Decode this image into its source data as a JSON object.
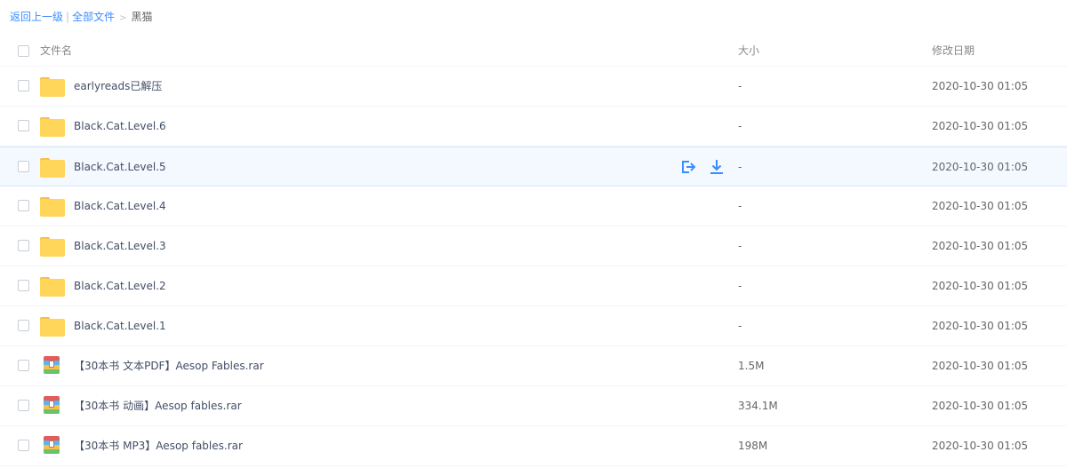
{
  "breadcrumb": {
    "back_label": "返回上一级",
    "separator": "|",
    "all_files_label": "全部文件",
    "arrow": ">",
    "current": "黑猫"
  },
  "header": {
    "name_label": "文件名",
    "size_label": "大小",
    "date_label": "修改日期"
  },
  "colors": {
    "accent": "#3b8cff",
    "folder": "#ffd659",
    "hover_row": "#f4f9ff"
  },
  "files": [
    {
      "type": "folder",
      "icon": "folder-icon",
      "name": "earlyreads已解压",
      "size": "-",
      "date": "2020-10-30 01:05"
    },
    {
      "type": "folder",
      "icon": "folder-icon",
      "name": "Black.Cat.Level.6",
      "size": "-",
      "date": "2020-10-30 01:05"
    },
    {
      "type": "folder",
      "icon": "folder-icon",
      "name": "Black.Cat.Level.5",
      "size": "-",
      "date": "2020-10-30 01:05",
      "hovered": true
    },
    {
      "type": "folder",
      "icon": "folder-icon",
      "name": "Black.Cat.Level.4",
      "size": "-",
      "date": "2020-10-30 01:05"
    },
    {
      "type": "folder",
      "icon": "folder-icon",
      "name": "Black.Cat.Level.3",
      "size": "-",
      "date": "2020-10-30 01:05"
    },
    {
      "type": "folder",
      "icon": "folder-icon",
      "name": "Black.Cat.Level.2",
      "size": "-",
      "date": "2020-10-30 01:05"
    },
    {
      "type": "folder",
      "icon": "folder-icon",
      "name": "Black.Cat.Level.1",
      "size": "-",
      "date": "2020-10-30 01:05"
    },
    {
      "type": "rar",
      "icon": "rar-archive-icon",
      "name": "【30本书 文本PDF】Aesop Fables.rar",
      "size": "1.5M",
      "date": "2020-10-30 01:05"
    },
    {
      "type": "rar",
      "icon": "rar-archive-icon",
      "name": "【30本书 动画】Aesop fables.rar",
      "size": "334.1M",
      "date": "2020-10-30 01:05"
    },
    {
      "type": "rar",
      "icon": "rar-archive-icon",
      "name": "【30本书 MP3】Aesop fables.rar",
      "size": "198M",
      "date": "2020-10-30 01:05"
    }
  ],
  "row_actions": {
    "share_icon": "share-icon",
    "download_icon": "download-icon"
  }
}
